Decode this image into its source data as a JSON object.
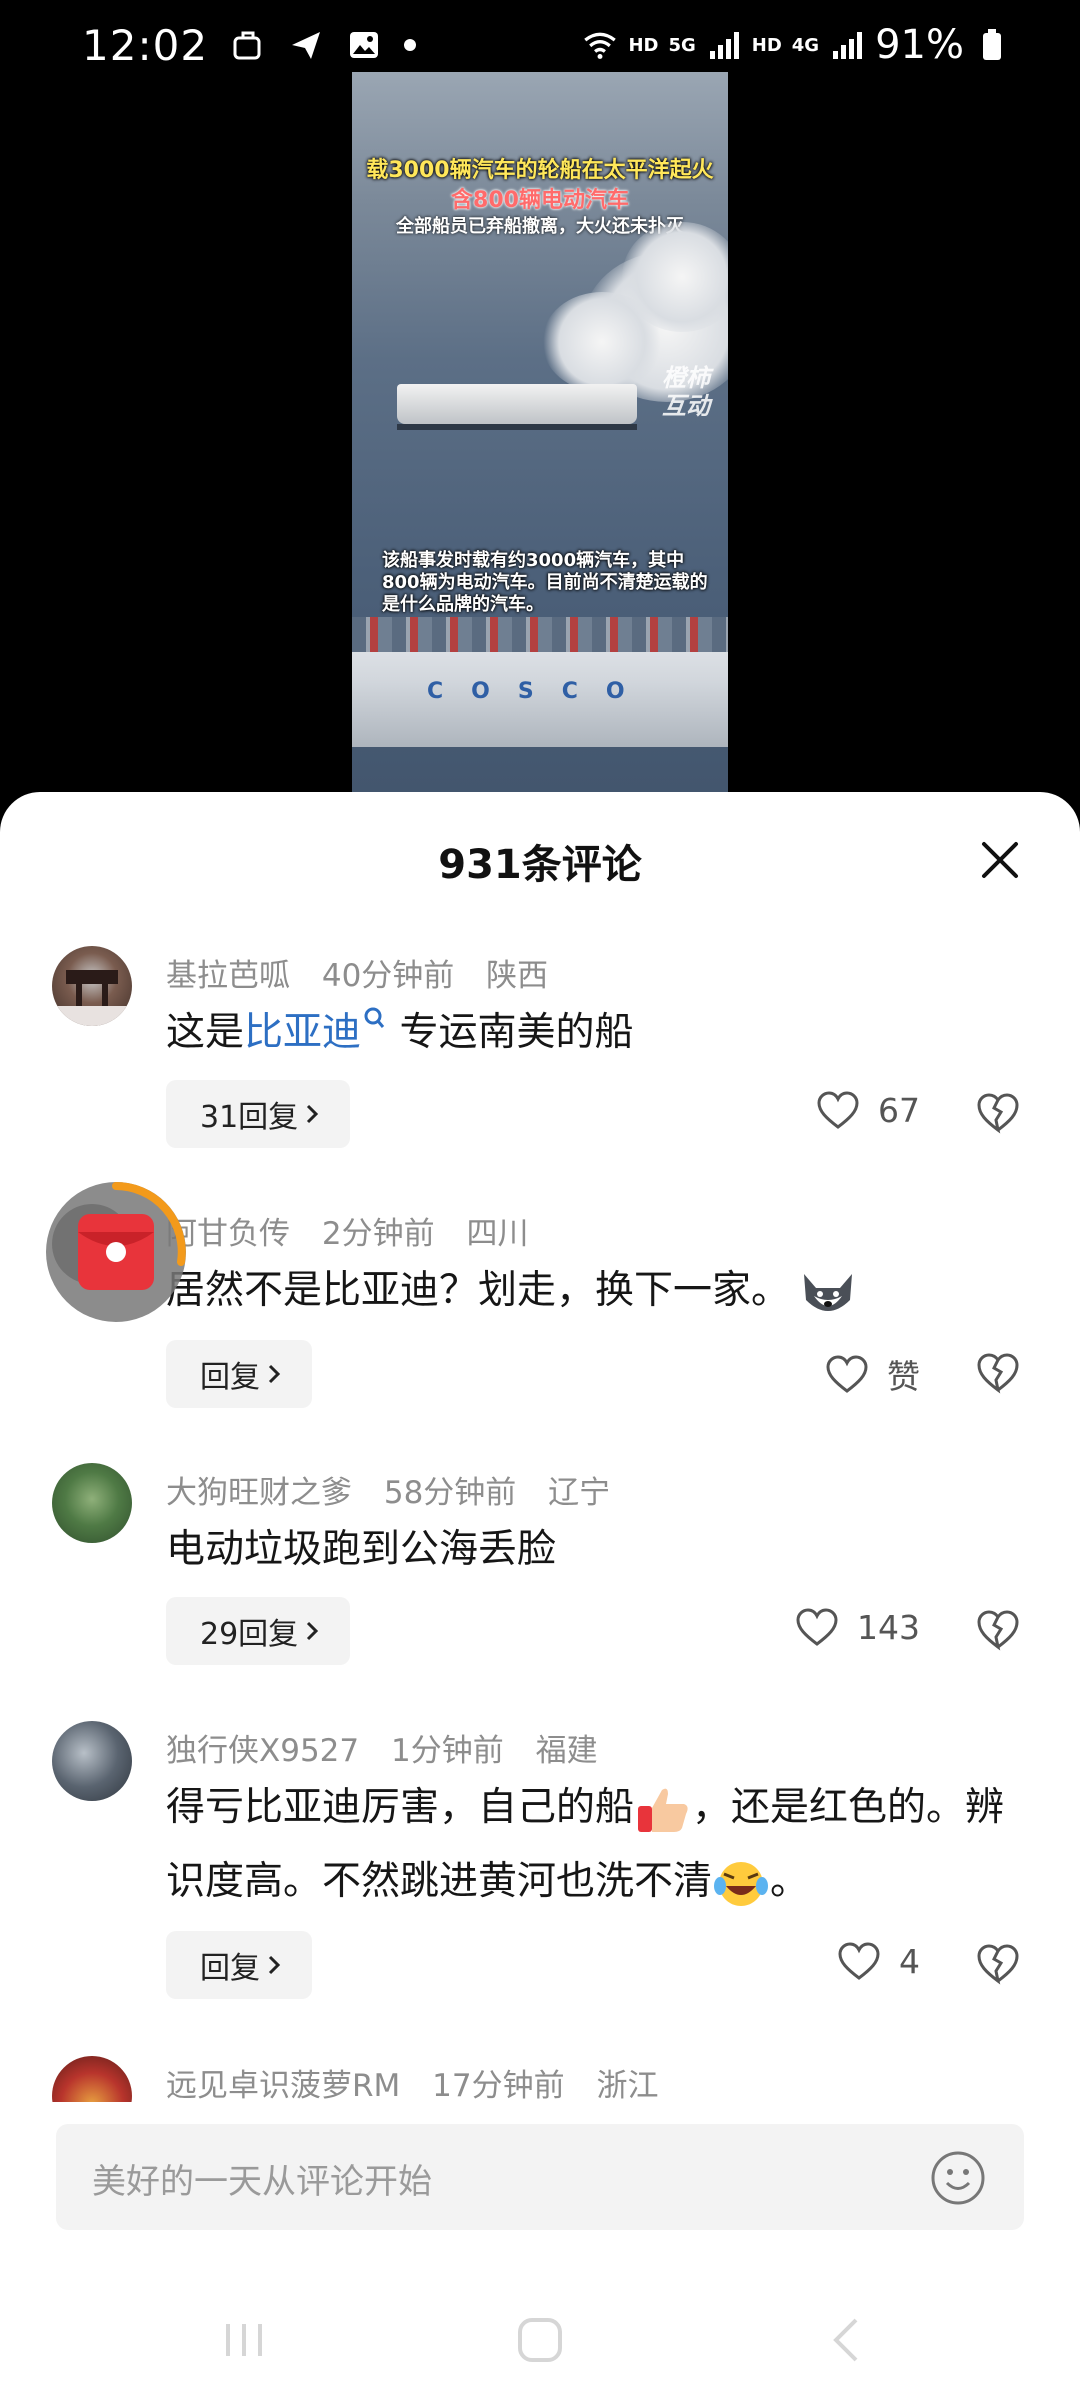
{
  "status_bar": {
    "time": "12:02",
    "hd1": "HD",
    "fiveg": "5G",
    "hd2": "HD",
    "fourg": "4G",
    "battery": "91%"
  },
  "video": {
    "title1": "载3000辆汽车的轮船在太平洋起火",
    "title2": "含800辆电动汽车",
    "title3": "全部船员已弃船撤离，大火还未扑灭",
    "watermark_line1": "橙柿",
    "watermark_line2": "互动",
    "caption": "该船事发时载有约3000辆汽车，其中800辆为电动汽车。目前尚不清楚运载的是什么品牌的汽车。",
    "ship_logo": "COSCO"
  },
  "comments_header": {
    "title": "931条评论"
  },
  "comments": [
    {
      "user": "基拉芭呱",
      "time": "40分钟前",
      "region": "陕西",
      "text_before": "这是",
      "link": "比亚迪",
      "text_after": "专运南美的船",
      "reply_label": "31回复",
      "likes": "67"
    },
    {
      "user": "阿甘负传",
      "time": "2分钟前",
      "region": "四川",
      "text": "居然不是比亚迪？划走，换下一家。",
      "reply_label": "回复",
      "likes": "赞"
    },
    {
      "user": "大狗旺财之爹",
      "time": "58分钟前",
      "region": "辽宁",
      "text": "电动垃圾跑到公海丢脸",
      "reply_label": "29回复",
      "likes": "143"
    },
    {
      "user": "独行侠X9527",
      "time": "1分钟前",
      "region": "福建",
      "text_part1": "得亏比亚迪厉害，自己的船",
      "text_part2": "，还是红色的。辨识度高。不然跳进黄河也洗不清",
      "text_part3": "。",
      "reply_label": "回复",
      "likes": "4"
    },
    {
      "user": "远见卓识菠萝RM",
      "time": "17分钟前",
      "region": "浙江"
    }
  ],
  "input": {
    "placeholder": "美好的一天从评论开始"
  },
  "icons": {
    "close": "close-icon",
    "like": "heart-icon",
    "dislike": "broken-heart-icon",
    "emoji": "smiley-icon",
    "red_packet": "red-envelope-icon"
  },
  "colors": {
    "link": "#2d6fc3",
    "red_packet": "#e8343b",
    "ring": "#f39a1b"
  }
}
